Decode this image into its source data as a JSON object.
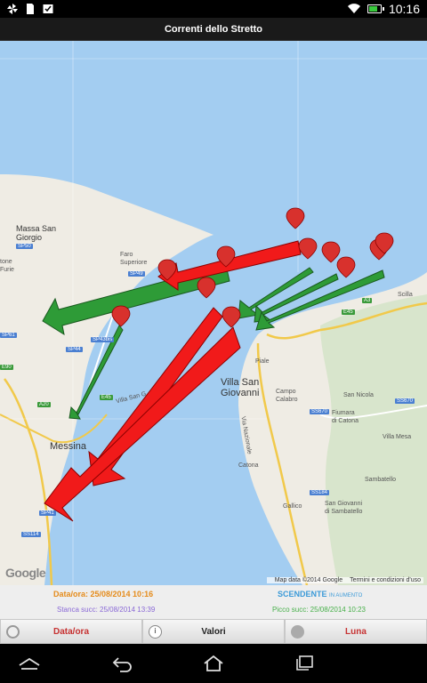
{
  "status_bar": {
    "time": "10:16",
    "icons": [
      "pinwheel-icon",
      "document-icon",
      "checkbox-icon",
      "wifi-icon",
      "battery-icon"
    ],
    "battery_color": "#39c93d"
  },
  "app": {
    "title": "Correnti dello Stretto"
  },
  "map": {
    "water_color": "#a3cdf1",
    "land_color": "#efece4",
    "arrow_colors": {
      "increasing": "#2e9b37",
      "decreasing": "#f11a1a"
    },
    "places": {
      "messina": "Messina",
      "villa_san_giovanni": "Villa San\nGiovanni",
      "massa_san_giorgio": "Massa San\nGiorgio",
      "faro_superiore": "Faro\nSuperiore",
      "piale": "Piale",
      "campo_calabro": "Campo\nCalabro",
      "fiumara_di_catona": "Fiumara\ndi Catona",
      "catona": "Catona",
      "san_nicola": "San Nicola",
      "villa_mesa": "Villa Mesa",
      "sambatello": "Sambatello",
      "san_giovanni_di_sambatello": "San Giovanni\ndi Sambatello",
      "gallico": "Gallico",
      "scilla": "Scilla",
      "tone_furie": "tone\nFurie",
      "villa_san_giovanni_ferry": "Villa San G",
      "via_nazionale": "Via Nazionale"
    },
    "roads": [
      "SP50",
      "SP49",
      "SP61",
      "SP43bis",
      "SP44",
      "E45",
      "E90",
      "A20",
      "SS113",
      "SP41",
      "SS114",
      "A3",
      "E45",
      "SS670",
      "SS184",
      "SS670"
    ],
    "google_logo": "Google",
    "attribution": "Map data ©2014 Google",
    "terms": "Termini e condizioni d'uso"
  },
  "info": {
    "datetime": "Data/ora: 25/08/2014 10:16",
    "trend": "SCENDENTE",
    "trend_sub": "IN AUMENTO",
    "stanca": "Stanca succ: 25/08/2014 13:39",
    "picco": "Picco succ: 25/08/2014 10:23"
  },
  "buttons": {
    "date": "Data/ora",
    "valori": "Valori",
    "luna": "Luna"
  },
  "nav": {
    "icons": [
      "back-icon",
      "home-icon",
      "recents-icon"
    ]
  }
}
